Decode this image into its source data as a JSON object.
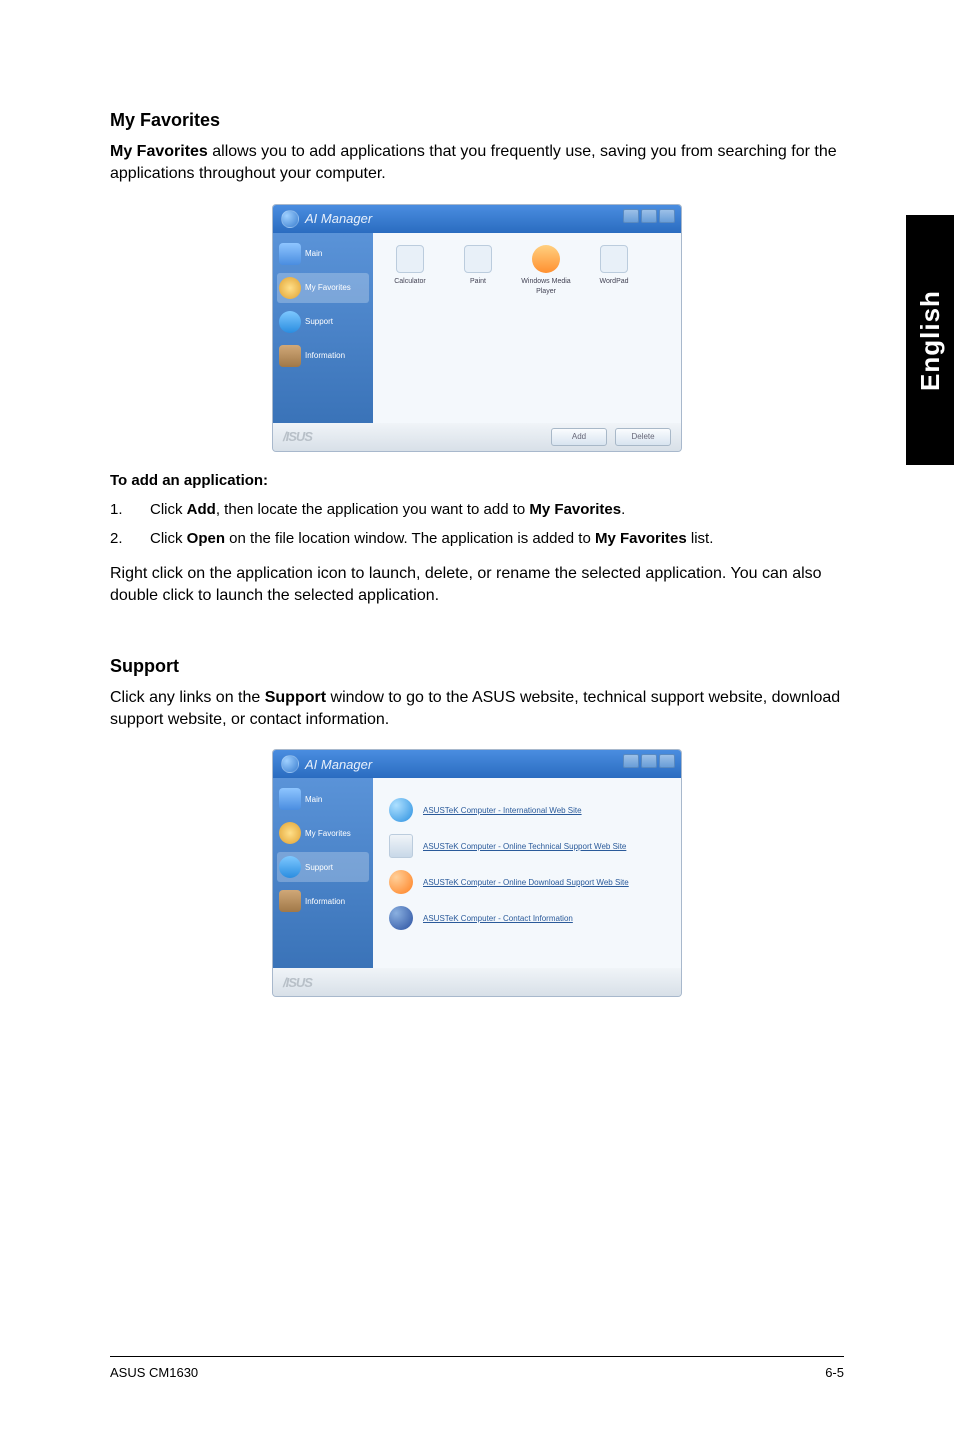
{
  "side_tab": "English",
  "my_favorites": {
    "heading": "My Favorites",
    "intro_prefix": "My Favorites",
    "intro_rest": " allows you to add applications that you frequently use, saving you from searching for the applications throughout your computer.",
    "add_heading": "To add an application:",
    "steps": [
      {
        "num": "1.",
        "pre": "Click ",
        "b1": "Add",
        "mid": ", then locate the application you want to add to ",
        "b2": "My Favorites",
        "post": "."
      },
      {
        "num": "2.",
        "pre": "Click ",
        "b1": "Open",
        "mid": " on the file location window. The application is added to ",
        "b2": "My Favorites",
        "post": " list."
      }
    ],
    "note": "Right click on the application icon to launch, delete, or rename the selected application. You can also double click to launch the selected application."
  },
  "support": {
    "heading": "Support",
    "intro_pre": "Click any links on the ",
    "intro_b": "Support",
    "intro_post": " window to go to the ASUS website, technical support website, download support website, or contact information."
  },
  "screenshot_fav": {
    "title": "AI Manager",
    "sidebar": [
      "Main",
      "My Favorites",
      "Support",
      "Information"
    ],
    "icons": [
      "Calculator",
      "Paint",
      "Windows Media Player",
      "WordPad"
    ],
    "brand": "/ISUS",
    "buttons": [
      "Add",
      "Delete"
    ]
  },
  "screenshot_support": {
    "title": "AI Manager",
    "sidebar": [
      "Main",
      "My Favorites",
      "Support",
      "Information"
    ],
    "links": [
      "ASUSTeK Computer - International Web Site",
      "ASUSTeK Computer - Online Technical Support Web Site",
      "ASUSTeK Computer - Online Download Support Web Site",
      "ASUSTeK Computer - Contact Information"
    ],
    "brand": "/ISUS"
  },
  "footer": {
    "left": "ASUS CM1630",
    "right": "6-5"
  }
}
